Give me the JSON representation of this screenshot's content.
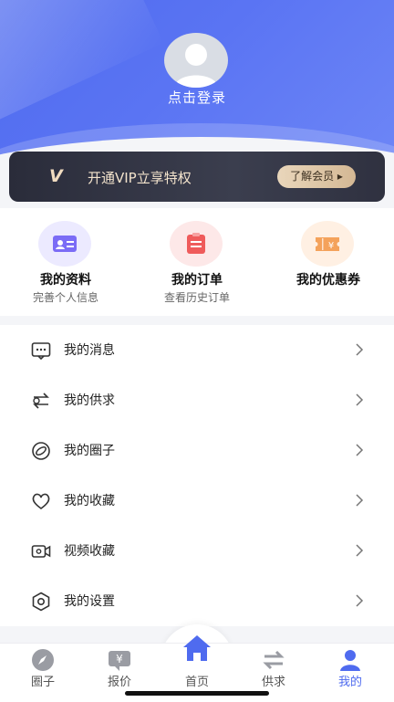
{
  "header": {
    "login_label": "点击登录"
  },
  "vip": {
    "logo": "V",
    "text": "开通VIP立享特权",
    "button": "了解会员 ▸"
  },
  "quick": [
    {
      "title": "我的资料",
      "subtitle": "完善个人信息",
      "icon": "id-card-icon",
      "bg": "#eceaff",
      "color": "#7b6cf6"
    },
    {
      "title": "我的订单",
      "subtitle": "查看历史订单",
      "icon": "order-icon",
      "bg": "#fde8e8",
      "color": "#ef5b5b"
    },
    {
      "title": "我的优惠券",
      "subtitle": "",
      "icon": "coupon-icon",
      "bg": "#fff0e3",
      "color": "#f4a25b"
    }
  ],
  "menu": [
    {
      "label": "我的消息",
      "icon": "message-icon"
    },
    {
      "label": "我的供求",
      "icon": "exchange-icon"
    },
    {
      "label": "我的圈子",
      "icon": "circle-icon"
    },
    {
      "label": "我的收藏",
      "icon": "heart-icon"
    },
    {
      "label": "视频收藏",
      "icon": "video-icon"
    },
    {
      "label": "我的设置",
      "icon": "settings-icon"
    }
  ],
  "tabs": [
    {
      "label": "圈子",
      "icon": "compass-icon"
    },
    {
      "label": "报价",
      "icon": "price-icon"
    },
    {
      "label": "首页",
      "icon": "home-icon"
    },
    {
      "label": "供求",
      "icon": "exchange-icon"
    },
    {
      "label": "我的",
      "icon": "user-icon",
      "active": true
    }
  ],
  "colors": {
    "accent": "#4f6bef",
    "vip_gold": "#f1dcc0"
  }
}
